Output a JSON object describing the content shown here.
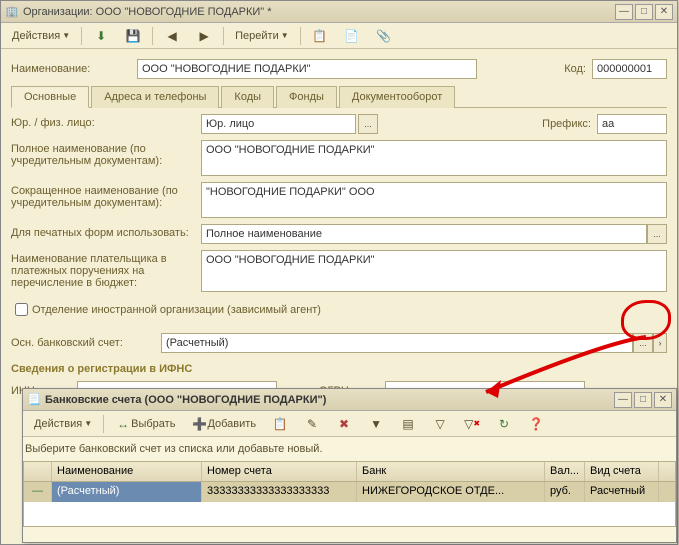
{
  "mainWindow": {
    "title": "Организации: ООО \"НОВОГОДНИЕ ПОДАРКИ\" *",
    "toolbar": {
      "actions": "Действия",
      "navigate": "Перейти"
    },
    "nameLabel": "Наименование:",
    "nameValue": "ООО \"НОВОГОДНИЕ ПОДАРКИ\"",
    "codeLabel": "Код:",
    "codeValue": "000000001",
    "tabs": [
      "Основные",
      "Адреса и телефоны",
      "Коды",
      "Фонды",
      "Документооборот"
    ],
    "legalLabel": "Юр. / физ. лицо:",
    "legalValue": "Юр. лицо",
    "prefixLabel": "Префикс:",
    "prefixValue": "аа",
    "fullNameLabel": "Полное наименование (по учредительным документам):",
    "fullNameValue": "ООО \"НОВОГОДНИЕ ПОДАРКИ\"",
    "shortNameLabel": "Сокращенное наименование (по учредительным документам):",
    "shortNameValue": "\"НОВОГОДНИЕ ПОДАРКИ\" ООО",
    "printFormLabel": "Для печатных форм использовать:",
    "printFormValue": "Полное наименование",
    "payerLabel": "Наименование плательщика в платежных поручениях на перечисление в бюджет:",
    "payerValue": "ООО \"НОВОГОДНИЕ ПОДАРКИ\"",
    "foreignLabel": "Отделение иностранной организации (зависимый агент)",
    "bankAccLabel": "Осн. банковский счет:",
    "bankAccValue": "(Расчетный)",
    "ifnsSection": "Сведения о регистрации в ИФНС",
    "innLabel": "ИНН:",
    "ogrnLabel": "ОГРН:"
  },
  "subWindow": {
    "title": "Банковские счета (ООО \"НОВОГОДНИЕ ПОДАРКИ\")",
    "toolbar": {
      "actions": "Действия",
      "select": "Выбрать",
      "add": "Добавить"
    },
    "hint": "Выберите банковский счет из списка или добавьте новый.",
    "columns": [
      "",
      "Наименование",
      "Номер счета",
      "Банк",
      "Вал...",
      "Вид счета"
    ],
    "row": {
      "name": "(Расчетный)",
      "number": "33333333333333333333",
      "bank": "НИЖЕГОРОДСКОЕ ОТДЕ...",
      "currency": "руб.",
      "type": "Расчетный"
    }
  }
}
